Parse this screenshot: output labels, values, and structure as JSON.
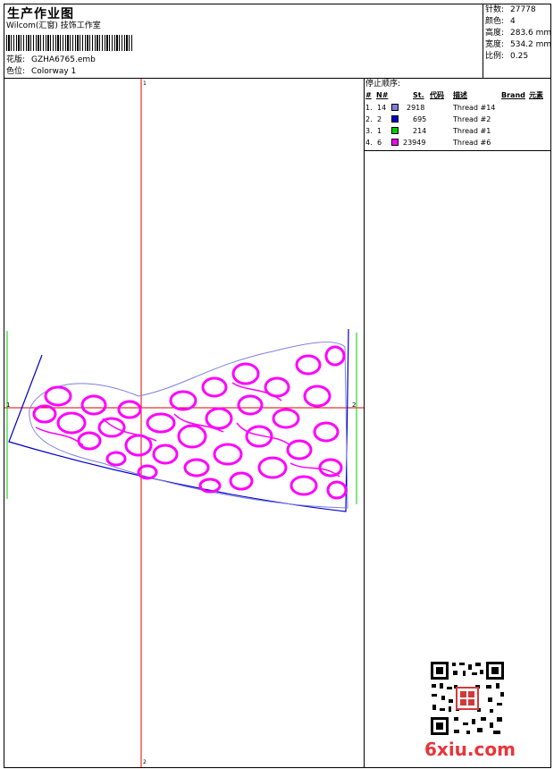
{
  "header": {
    "title": "生产作业图",
    "studio": "Wilcom(汇窗) 技饰工作室",
    "design_label": "花版:",
    "design_file": "GZHA6765.emb",
    "colorway_label": "色位:",
    "colorway": "Colorway 1"
  },
  "stats": [
    {
      "label": "针数:",
      "value": "27778"
    },
    {
      "label": "颜色:",
      "value": "4"
    },
    {
      "label": "高度:",
      "value": "283.6 mm"
    },
    {
      "label": "宽度:",
      "value": "534.2 mm"
    },
    {
      "label": "比例:",
      "value": "0.25"
    }
  ],
  "stop_sequence": {
    "title": "停止顺序:",
    "columns": [
      "#",
      "N#",
      "St.",
      "代码",
      "描述",
      "Brand",
      "元素"
    ],
    "rows": [
      {
        "idx": "1.",
        "n": "14",
        "color": "#7f7fe0",
        "st": "2918",
        "code": "",
        "desc": "Thread #14"
      },
      {
        "idx": "2.",
        "n": "2",
        "color": "#0000cc",
        "st": "695",
        "code": "",
        "desc": "Thread #2"
      },
      {
        "idx": "3.",
        "n": "1",
        "color": "#00cc00",
        "st": "214",
        "code": "",
        "desc": "Thread #1"
      },
      {
        "idx": "4.",
        "n": "6",
        "color": "#ff00ff",
        "st": "23949",
        "code": "",
        "desc": "Thread #6"
      }
    ]
  },
  "canvas": {
    "marker_left": "1",
    "marker_right": "2",
    "marker_top": "1",
    "marker_bottom": "2"
  },
  "colors": {
    "crosshair": "#e00000",
    "outline": "#0000cc",
    "guide": "#00cc00",
    "fill": "#ff00ff"
  },
  "watermark": "6xiu.com"
}
